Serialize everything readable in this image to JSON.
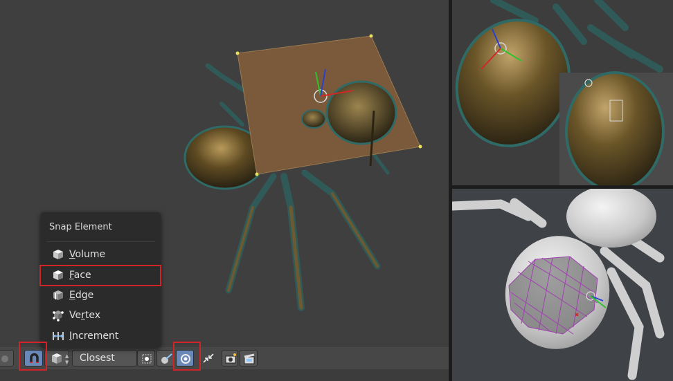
{
  "snap_menu": {
    "title": "Snap Element",
    "items": [
      {
        "pre": "",
        "key": "V",
        "post": "olume",
        "icon": "cube-icon"
      },
      {
        "pre": "",
        "key": "F",
        "post": "ace",
        "icon": "face-cube-icon",
        "highlighted": true
      },
      {
        "pre": "",
        "key": "E",
        "post": "dge",
        "icon": "edge-cube-icon"
      },
      {
        "pre": "Ve",
        "key": "r",
        "post": "tex",
        "icon": "vertex-cube-icon"
      },
      {
        "pre": "",
        "key": "I",
        "post": "ncrement",
        "icon": "increment-icon"
      }
    ]
  },
  "header": {
    "snap_target": "Closest"
  },
  "colors": {
    "highlight": "#d0242a",
    "menu_bg": "#2b2b2b",
    "plane": "#7a5a3a"
  }
}
